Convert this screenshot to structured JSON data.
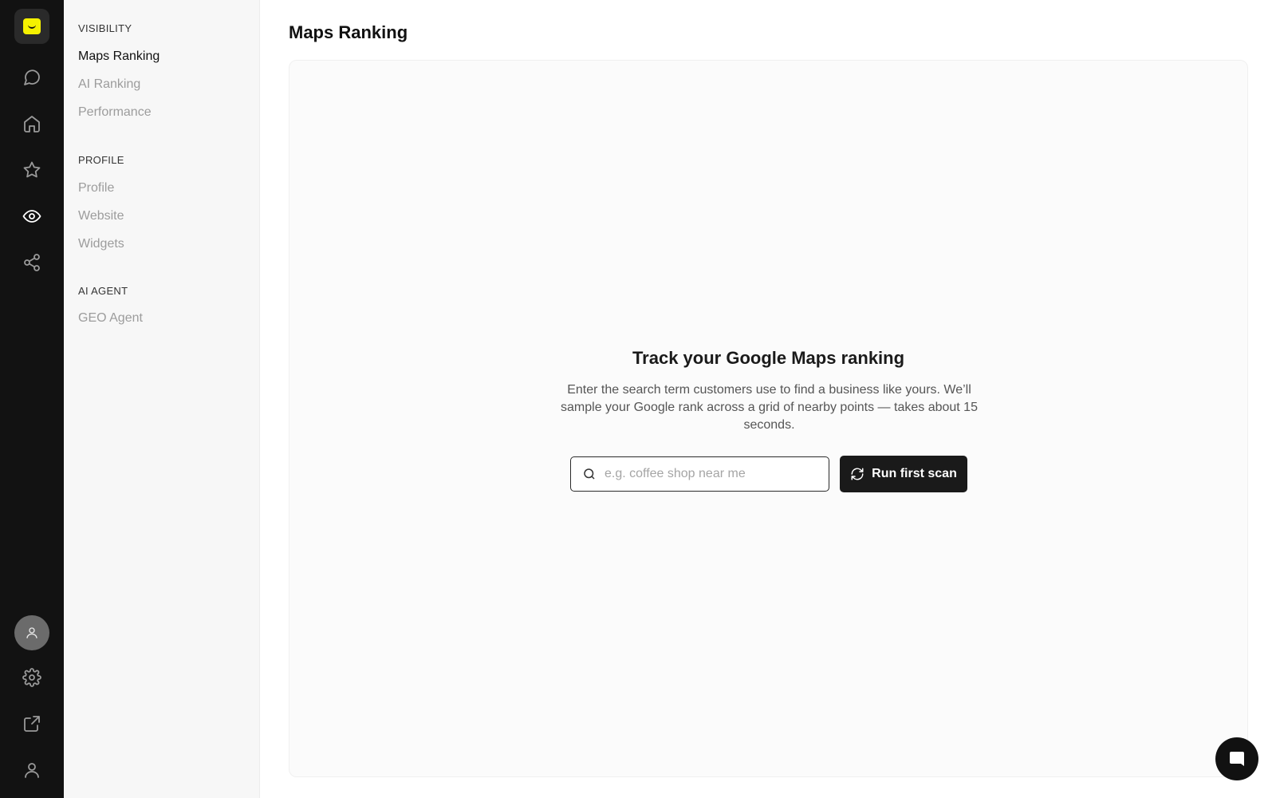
{
  "rail": {
    "items": [
      {
        "icon": "logo-icon"
      },
      {
        "icon": "chat-bubble-icon"
      },
      {
        "icon": "home-icon"
      },
      {
        "icon": "star-icon"
      },
      {
        "icon": "eye-icon",
        "active": true
      },
      {
        "icon": "share-icon"
      },
      {
        "icon": "avatar-icon"
      },
      {
        "icon": "gear-icon"
      },
      {
        "icon": "external-link-icon"
      },
      {
        "icon": "user-icon"
      }
    ]
  },
  "subnav": {
    "sections": [
      {
        "title": "VISIBILITY",
        "items": [
          "Maps Ranking",
          "AI Ranking",
          "Performance"
        ]
      },
      {
        "title": "PROFILE",
        "items": [
          "Profile",
          "Website",
          "Widgets"
        ]
      },
      {
        "title": "AI AGENT",
        "items": [
          "GEO Agent"
        ]
      }
    ],
    "active_item": "Maps Ranking"
  },
  "main": {
    "page_title": "Maps Ranking",
    "empty_state": {
      "title": "Track your Google Maps ranking",
      "description": "Enter the search term customers use to find a business like yours. We’ll sample your Google rank across a grid of nearby points — takes about 15 seconds.",
      "search_placeholder": "e.g. coffee shop near me",
      "search_value": "",
      "button_label": "Run first scan"
    }
  },
  "colors": {
    "rail_bg": "#121212",
    "subnav_bg": "#f7f7f7",
    "logo_accent": "#f5f100",
    "button_bg": "#1a1a1a"
  }
}
